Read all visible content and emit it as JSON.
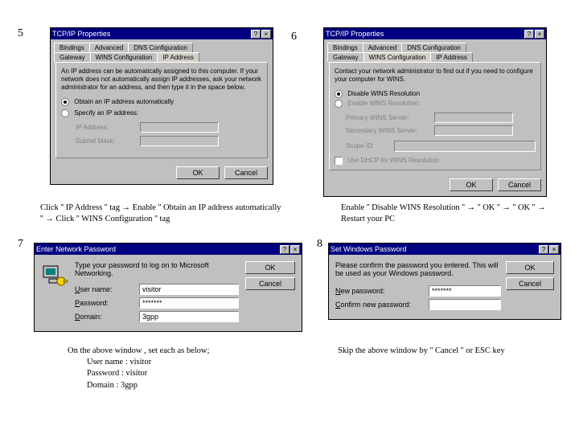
{
  "steps": {
    "s5": "5",
    "s6": "6",
    "s7": "7",
    "s8": "8"
  },
  "panel5": {
    "title": "TCP/IP Properties",
    "tabs_row1": [
      "Bindings",
      "Advanced",
      "DNS Configuration"
    ],
    "tabs_row2": [
      "Gateway",
      "WINS Configuration",
      "IP Address"
    ],
    "intro": "An IP address can be automatically assigned to this computer. If your network does not automatically assign IP addresses, ask your network administrator for an address, and then type it in the space below.",
    "opt_auto": "Obtain an IP address automatically",
    "opt_spec": "Specify an IP address:",
    "lbl_ip": "IP Address:",
    "lbl_mask": "Subnet Mask:",
    "ok": "OK",
    "cancel": "Cancel"
  },
  "panel6": {
    "title": "TCP/IP Properties",
    "tabs_row1": [
      "Bindings",
      "Advanced",
      "DNS Configuration"
    ],
    "tabs_row2": [
      "Gateway",
      "WINS Configuration",
      "IP Address"
    ],
    "intro": "Contact your network administrator to find out if you need to configure your computer for WINS.",
    "opt_disable": "Disable WINS Resolution",
    "opt_enable": "Enable WINS Resolution:",
    "lbl_primary": "Primary WINS Server:",
    "lbl_secondary": "Secondary WINS Server:",
    "lbl_scope": "Scope ID:",
    "chk_dhcp": "Use DHCP for WINS Resolution",
    "ok": "OK",
    "cancel": "Cancel"
  },
  "panel7": {
    "title": "Enter Network Password",
    "msg": "Type your password to log on to Microsoft Networking.",
    "lbl_user": "User name:",
    "lbl_pass": "Password:",
    "lbl_domain": "Domain:",
    "val_user": "visitor",
    "val_pass": "*******",
    "val_domain": "3gpp",
    "ok": "OK",
    "cancel": "Cancel"
  },
  "panel8": {
    "title": "Set Windows Password",
    "msg": "Please confirm the password you entered. This will be used as your Windows password.",
    "lbl_new": "New password:",
    "lbl_confirm": "Confirm new password:",
    "val_new": "*******",
    "val_confirm": "",
    "ok": "OK",
    "cancel": "Cancel"
  },
  "captions": {
    "c5": "Click '' IP Address '' tag → Enable '' Obtain an IP address automatically '' → Click '' WINS Configuration '' tag",
    "c6": "Enable '' Disable WINS Resolution '' → '' OK '' → '' OK '' → Restart your PC",
    "c7_lead": "On the above window , set each as below;",
    "c7_user": "User name  :  visitor",
    "c7_pass": "Password   :  visitor",
    "c7_dom": "Domain      :  3gpp",
    "c8": "Skip the above window by '' Cancel '' or ESC key"
  }
}
